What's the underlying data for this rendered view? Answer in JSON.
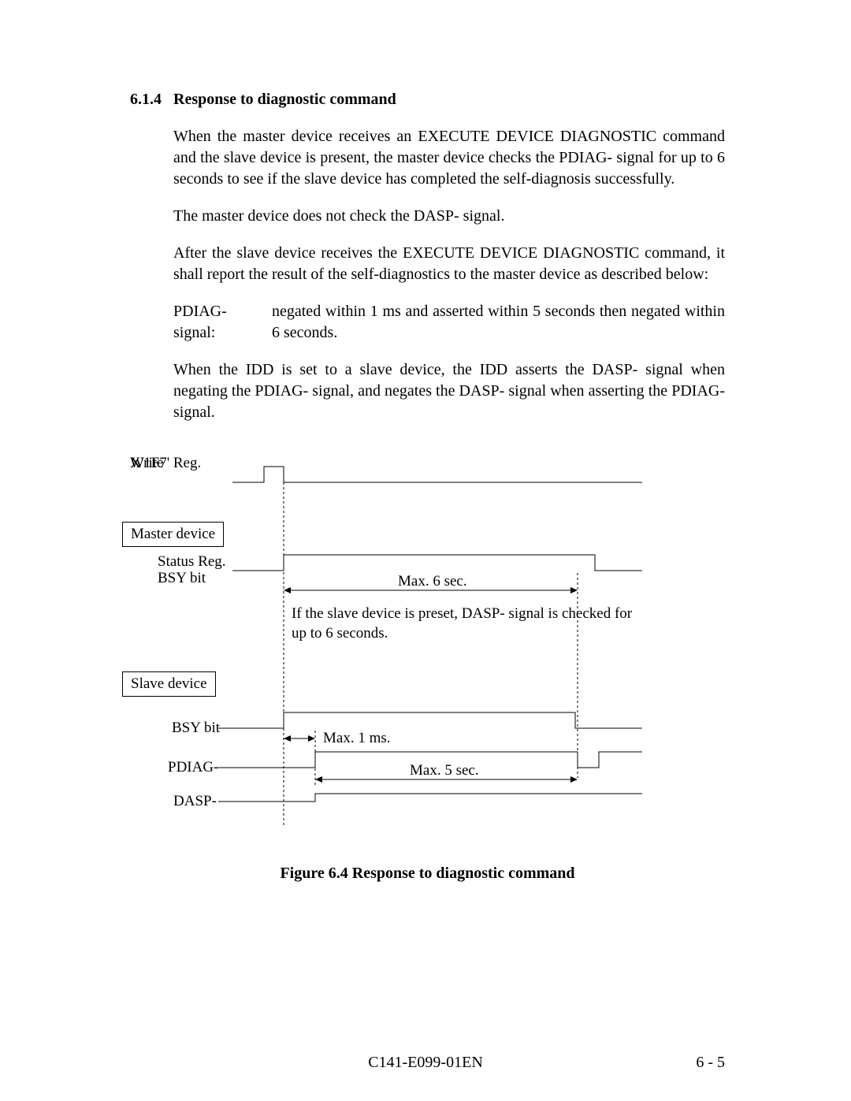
{
  "section": {
    "number": "6.1.4",
    "title": "Response to diagnostic command"
  },
  "paragraphs": {
    "p1": "When the master device receives an EXECUTE DEVICE DIAGNOSTIC command and the slave device is present, the master device checks the PDIAG- signal for up to 6 seconds to see if the slave device has completed the self-diagnosis successfully.",
    "p2": "The master device does not check the DASP- signal.",
    "p3": "After the slave device receives the EXECUTE DEVICE DIAGNOSTIC command, it shall report the result of the self-diagnostics to the master device as described below:",
    "p4_label": "PDIAG- signal:",
    "p4_desc": "negated within 1 ms and asserted within 5 seconds then negated within 6 seconds.",
    "p5": "When the IDD is set to a slave device, the IDD asserts the DASP- signal when negating the PDIAG- signal, and negates the DASP- signal when asserting the PDIAG- signal."
  },
  "diagram": {
    "label_x1f7_1": "X'1F7' Reg.",
    "label_x1f7_2": "Write",
    "label_master": "Master device",
    "label_status_1": "Status Reg.",
    "label_status_2": "BSY bit",
    "label_max6": "Max. 6 sec.",
    "label_note": "If the slave device is preset, DASP- signal is checked for up to 6 seconds.",
    "label_slave": "Slave device",
    "label_bsy": "BSY bit",
    "label_max1": "Max. 1 ms.",
    "label_pdiag": "PDIAG-",
    "label_max5": "Max. 5 sec.",
    "label_dasp": "DASP-"
  },
  "figure_caption": "Figure 6.4    Response to diagnostic command",
  "footer": {
    "center": "C141-E099-01EN",
    "right": "6 - 5"
  }
}
